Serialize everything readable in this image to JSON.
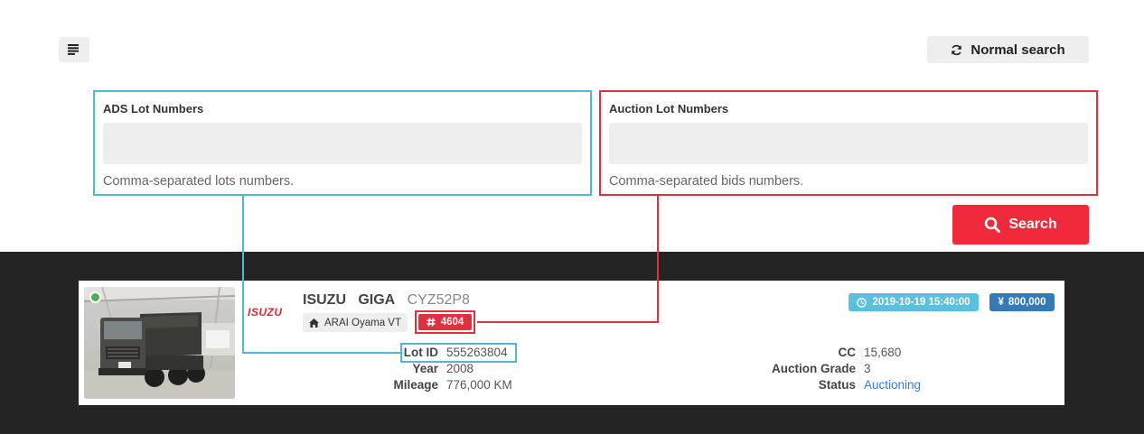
{
  "toolbar": {
    "menu_icon": "list-icon",
    "normal_search_label": "Normal search",
    "normal_search_icon": "refresh-icon"
  },
  "ads_lots": {
    "label": "ADS Lot Numbers",
    "value": "",
    "help": "Comma-separated lots numbers."
  },
  "auction_lots": {
    "label": "Auction Lot Numbers",
    "value": "",
    "help": "Comma-separated bids numbers."
  },
  "search": {
    "label": "Search",
    "icon": "search-icon"
  },
  "result": {
    "brand_logo": "ISUZU",
    "make": "ISUZU",
    "model": "GIGA",
    "chassis": "CYZ52P8",
    "auction_house": "ARAI Oyama VT",
    "lot_number": "4604",
    "date": "2019-10-19 15:40:00",
    "price": "800,000",
    "lot_id_label": "Lot ID",
    "lot_id": "555263804",
    "year_label": "Year",
    "year": "2008",
    "mileage_label": "Mileage",
    "mileage": "776,000 KM",
    "cc_label": "CC",
    "cc": "15,680",
    "grade_label": "Auction Grade",
    "grade": "3",
    "status_label": "Status",
    "status": "Auctioning"
  },
  "colors": {
    "ads_highlight": "#4fb8d2",
    "auction_highlight": "#e0303f",
    "search_button": "#f12a3b",
    "date_badge": "#5bc0de",
    "price_badge": "#337ab7",
    "dark_band": "#242424"
  }
}
